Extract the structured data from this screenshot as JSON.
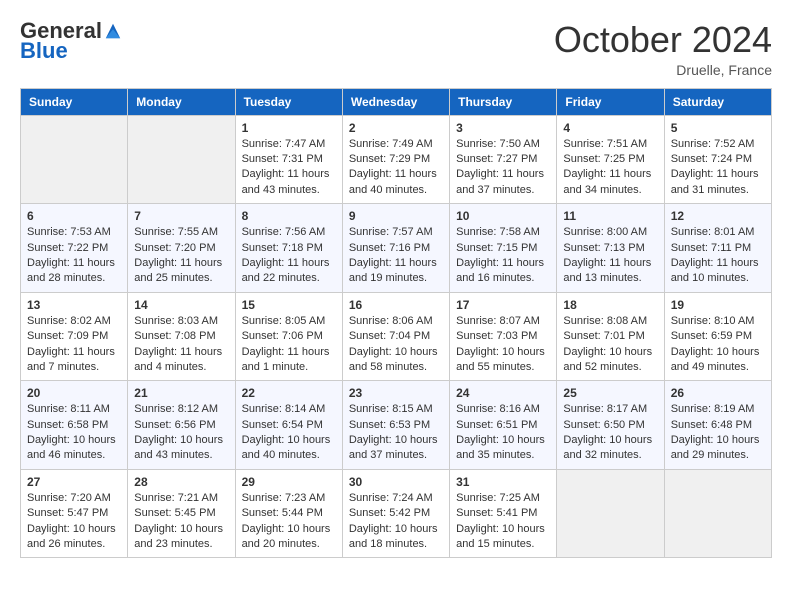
{
  "header": {
    "logo_general": "General",
    "logo_blue": "Blue",
    "month": "October 2024",
    "location": "Druelle, France"
  },
  "weekdays": [
    "Sunday",
    "Monday",
    "Tuesday",
    "Wednesday",
    "Thursday",
    "Friday",
    "Saturday"
  ],
  "weeks": [
    [
      null,
      null,
      {
        "day": 1,
        "sunrise": "7:47 AM",
        "sunset": "7:31 PM",
        "daylight": "11 hours and 43 minutes."
      },
      {
        "day": 2,
        "sunrise": "7:49 AM",
        "sunset": "7:29 PM",
        "daylight": "11 hours and 40 minutes."
      },
      {
        "day": 3,
        "sunrise": "7:50 AM",
        "sunset": "7:27 PM",
        "daylight": "11 hours and 37 minutes."
      },
      {
        "day": 4,
        "sunrise": "7:51 AM",
        "sunset": "7:25 PM",
        "daylight": "11 hours and 34 minutes."
      },
      {
        "day": 5,
        "sunrise": "7:52 AM",
        "sunset": "7:24 PM",
        "daylight": "11 hours and 31 minutes."
      }
    ],
    [
      {
        "day": 6,
        "sunrise": "7:53 AM",
        "sunset": "7:22 PM",
        "daylight": "11 hours and 28 minutes."
      },
      {
        "day": 7,
        "sunrise": "7:55 AM",
        "sunset": "7:20 PM",
        "daylight": "11 hours and 25 minutes."
      },
      {
        "day": 8,
        "sunrise": "7:56 AM",
        "sunset": "7:18 PM",
        "daylight": "11 hours and 22 minutes."
      },
      {
        "day": 9,
        "sunrise": "7:57 AM",
        "sunset": "7:16 PM",
        "daylight": "11 hours and 19 minutes."
      },
      {
        "day": 10,
        "sunrise": "7:58 AM",
        "sunset": "7:15 PM",
        "daylight": "11 hours and 16 minutes."
      },
      {
        "day": 11,
        "sunrise": "8:00 AM",
        "sunset": "7:13 PM",
        "daylight": "11 hours and 13 minutes."
      },
      {
        "day": 12,
        "sunrise": "8:01 AM",
        "sunset": "7:11 PM",
        "daylight": "11 hours and 10 minutes."
      }
    ],
    [
      {
        "day": 13,
        "sunrise": "8:02 AM",
        "sunset": "7:09 PM",
        "daylight": "11 hours and 7 minutes."
      },
      {
        "day": 14,
        "sunrise": "8:03 AM",
        "sunset": "7:08 PM",
        "daylight": "11 hours and 4 minutes."
      },
      {
        "day": 15,
        "sunrise": "8:05 AM",
        "sunset": "7:06 PM",
        "daylight": "11 hours and 1 minute."
      },
      {
        "day": 16,
        "sunrise": "8:06 AM",
        "sunset": "7:04 PM",
        "daylight": "10 hours and 58 minutes."
      },
      {
        "day": 17,
        "sunrise": "8:07 AM",
        "sunset": "7:03 PM",
        "daylight": "10 hours and 55 minutes."
      },
      {
        "day": 18,
        "sunrise": "8:08 AM",
        "sunset": "7:01 PM",
        "daylight": "10 hours and 52 minutes."
      },
      {
        "day": 19,
        "sunrise": "8:10 AM",
        "sunset": "6:59 PM",
        "daylight": "10 hours and 49 minutes."
      }
    ],
    [
      {
        "day": 20,
        "sunrise": "8:11 AM",
        "sunset": "6:58 PM",
        "daylight": "10 hours and 46 minutes."
      },
      {
        "day": 21,
        "sunrise": "8:12 AM",
        "sunset": "6:56 PM",
        "daylight": "10 hours and 43 minutes."
      },
      {
        "day": 22,
        "sunrise": "8:14 AM",
        "sunset": "6:54 PM",
        "daylight": "10 hours and 40 minutes."
      },
      {
        "day": 23,
        "sunrise": "8:15 AM",
        "sunset": "6:53 PM",
        "daylight": "10 hours and 37 minutes."
      },
      {
        "day": 24,
        "sunrise": "8:16 AM",
        "sunset": "6:51 PM",
        "daylight": "10 hours and 35 minutes."
      },
      {
        "day": 25,
        "sunrise": "8:17 AM",
        "sunset": "6:50 PM",
        "daylight": "10 hours and 32 minutes."
      },
      {
        "day": 26,
        "sunrise": "8:19 AM",
        "sunset": "6:48 PM",
        "daylight": "10 hours and 29 minutes."
      }
    ],
    [
      {
        "day": 27,
        "sunrise": "7:20 AM",
        "sunset": "5:47 PM",
        "daylight": "10 hours and 26 minutes."
      },
      {
        "day": 28,
        "sunrise": "7:21 AM",
        "sunset": "5:45 PM",
        "daylight": "10 hours and 23 minutes."
      },
      {
        "day": 29,
        "sunrise": "7:23 AM",
        "sunset": "5:44 PM",
        "daylight": "10 hours and 20 minutes."
      },
      {
        "day": 30,
        "sunrise": "7:24 AM",
        "sunset": "5:42 PM",
        "daylight": "10 hours and 18 minutes."
      },
      {
        "day": 31,
        "sunrise": "7:25 AM",
        "sunset": "5:41 PM",
        "daylight": "10 hours and 15 minutes."
      },
      null,
      null
    ]
  ],
  "labels": {
    "sunrise": "Sunrise: ",
    "sunset": "Sunset: ",
    "daylight": "Daylight: "
  }
}
